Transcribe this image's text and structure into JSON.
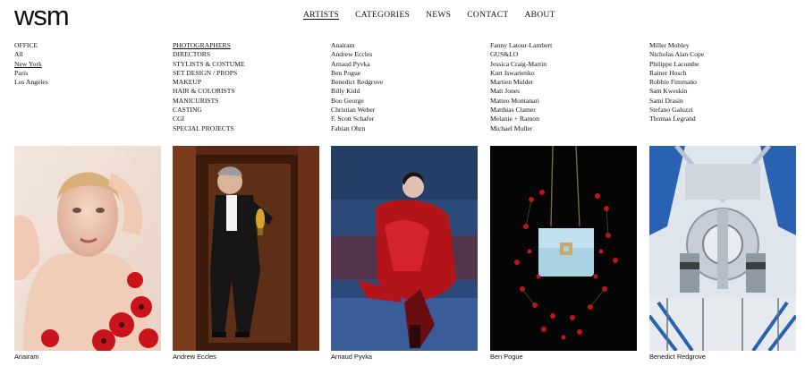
{
  "brand": {
    "logo_text": "wsm"
  },
  "nav": [
    {
      "label": "ARTISTS",
      "active": true
    },
    {
      "label": "CATEGORIES",
      "active": false
    },
    {
      "label": "NEWS",
      "active": false
    },
    {
      "label": "CONTACT",
      "active": false
    },
    {
      "label": "ABOUT",
      "active": false
    }
  ],
  "office": {
    "heading": "OFFICE",
    "items": [
      "All",
      "New York",
      "Paris",
      "Los Angeles"
    ],
    "selected": "New York"
  },
  "categories": {
    "items": [
      "PHOTOGRAPHERS",
      "DIRECTORS",
      "STYLISTS & COSTUME",
      "SET DESIGN / PROPS",
      "MAKEUP",
      "HAIR & COLORISTS",
      "MANICURISTS",
      "CASTING",
      "CGI",
      "SPECIAL PROJECTS"
    ],
    "selected": "PHOTOGRAPHERS"
  },
  "artists": {
    "col1": [
      "Anairam",
      "Andrew Eccles",
      "Arnaud Pyvka",
      "Ben Pogue",
      "Benedict Redgrove",
      "Billy Kidd",
      "Boo George",
      "Christian Weber",
      "F. Scott Schafer",
      "Fabian Ohrn"
    ],
    "col2": [
      "Fanny Latour-Lambert",
      "GUS&LO",
      "Jessica Craig-Martin",
      "Kurt Iswarienko",
      "Martien Mulder",
      "Matt Jones",
      "Matteo Montanari",
      "Matthias Clamer",
      "Melanie + Ramon",
      "Michael Muller"
    ],
    "col3": [
      "Miller Mobley",
      "Nicholas Alan Cope",
      "Philippe Lacombe",
      "Rainer Hosch",
      "Robbie Fimmano",
      "Sam Kweskin",
      "Sami Drasin",
      "Stefano Galuzzi",
      "Thomas Legrand"
    ]
  },
  "featured": [
    {
      "name": "Anairam",
      "icon": "portrait-photo"
    },
    {
      "name": "Andrew Eccles",
      "icon": "doorway-portrait-photo"
    },
    {
      "name": "Arnaud Pyvka",
      "icon": "red-coat-photo"
    },
    {
      "name": "Ben Pogue",
      "icon": "handbag-photo"
    },
    {
      "name": "Benedict Redgrove",
      "icon": "machinery-photo"
    }
  ],
  "colors": {
    "text": "#111111",
    "background": "#ffffff",
    "accent_red": "#c0141a"
  }
}
